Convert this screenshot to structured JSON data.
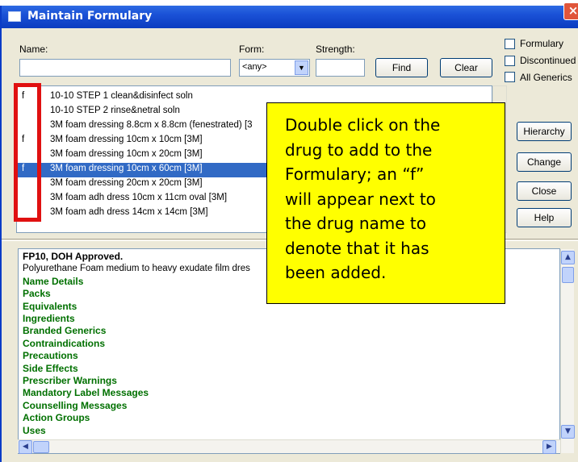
{
  "window": {
    "title": "Maintain Formulary",
    "close_label": "×"
  },
  "search": {
    "name_label": "Name:",
    "name_value": "",
    "form_label": "Form:",
    "form_value": "<any>",
    "strength_label": "Strength:",
    "strength_value": "",
    "find_label": "Find",
    "clear_label": "Clear"
  },
  "filters": [
    {
      "label": "Formulary",
      "checked": false
    },
    {
      "label": "Discontinued",
      "checked": false
    },
    {
      "label": "All Generics",
      "checked": false
    }
  ],
  "side_buttons": {
    "hierarchy": "Hierarchy",
    "change": "Change",
    "close": "Close",
    "help": "Help"
  },
  "drugs": [
    {
      "flag": "f",
      "name": "10-10 STEP 1 clean&disinfect soln",
      "selected": false
    },
    {
      "flag": "",
      "name": "10-10 STEP 2 rinse&netral soln",
      "selected": false
    },
    {
      "flag": "",
      "name": "3M foam dressing 8.8cm x 8.8cm (fenestrated) [3",
      "selected": false
    },
    {
      "flag": "f",
      "name": "3M foam dressing 10cm x 10cm [3M]",
      "selected": false
    },
    {
      "flag": "",
      "name": "3M foam dressing 10cm x 20cm [3M]",
      "selected": false
    },
    {
      "flag": "f",
      "name": "3M foam dressing 10cm x 60cm [3M]",
      "selected": true
    },
    {
      "flag": "",
      "name": "3M foam dressing 20cm x 20cm [3M]",
      "selected": false
    },
    {
      "flag": "",
      "name": "3M foam adh dress 10cm x 11cm oval [3M]",
      "selected": false
    },
    {
      "flag": "",
      "name": "3M foam adh dress 14cm x 14cm [3M]",
      "selected": false
    }
  ],
  "details": {
    "title": "FP10, DOH Approved.",
    "description": "Polyurethane Foam medium to heavy exudate film dres",
    "sections": [
      "Name Details",
      "Packs",
      "Equivalents",
      "Ingredients",
      "Branded Generics",
      "Contraindications",
      "Precautions",
      "Side Effects",
      "Prescriber Warnings",
      "Mandatory Label Messages",
      "Counselling Messages",
      "Action Groups",
      "Uses"
    ]
  },
  "callout": {
    "lines": [
      "Double click on the",
      "drug to add to the",
      "Formulary; an “f”",
      "will appear next to",
      "the drug name to",
      "denote that it has",
      "been added."
    ],
    "background": "#ffff00"
  },
  "colors": {
    "title_bar": "#0b3cc0",
    "selection": "#316ac5",
    "section_text": "#007000",
    "highlight_box": "#e01010"
  }
}
